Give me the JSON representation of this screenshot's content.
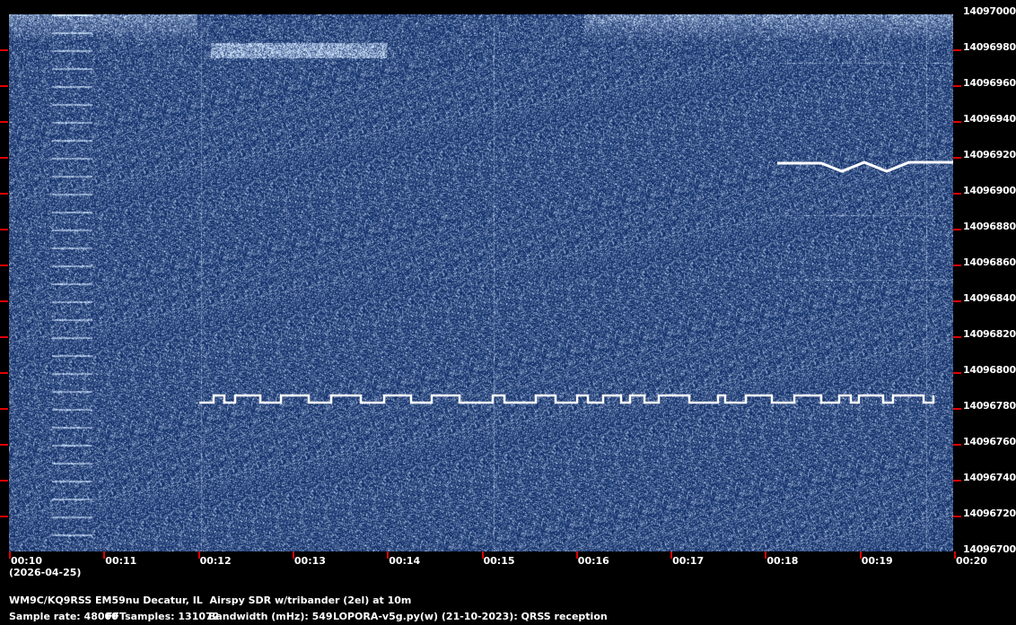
{
  "spectrogram": {
    "freq_labels": [
      "14097000",
      "14096980",
      "14096960",
      "14096940",
      "14096920",
      "14096900",
      "14096880",
      "14096860",
      "14096840",
      "14096820",
      "14096800",
      "14096780",
      "14096760",
      "14096740",
      "14096720",
      "14096700"
    ],
    "time_labels": [
      "00:10",
      "00:11",
      "00:12",
      "00:13",
      "00:14",
      "00:15",
      "00:16",
      "00:17",
      "00:18",
      "00:19",
      "00:20"
    ],
    "date_label": "(2026-04-25)",
    "colors": {
      "background": "#0a2a66",
      "signal": "#ffffff",
      "tick": "#e00000"
    }
  },
  "info": {
    "station": "WM9C/KQ9RSS EM59nu Decatur, IL  Airspy SDR w/tribander (2el) at 10m",
    "sample_rate": "Sample rate: 48000",
    "fft_samples": "FFTsamples: 131072",
    "bandwidth": "Bandwidth (mHz): 549",
    "software": "LOPORA-v5g.py(w) (21-10-2023): QRSS reception"
  }
}
